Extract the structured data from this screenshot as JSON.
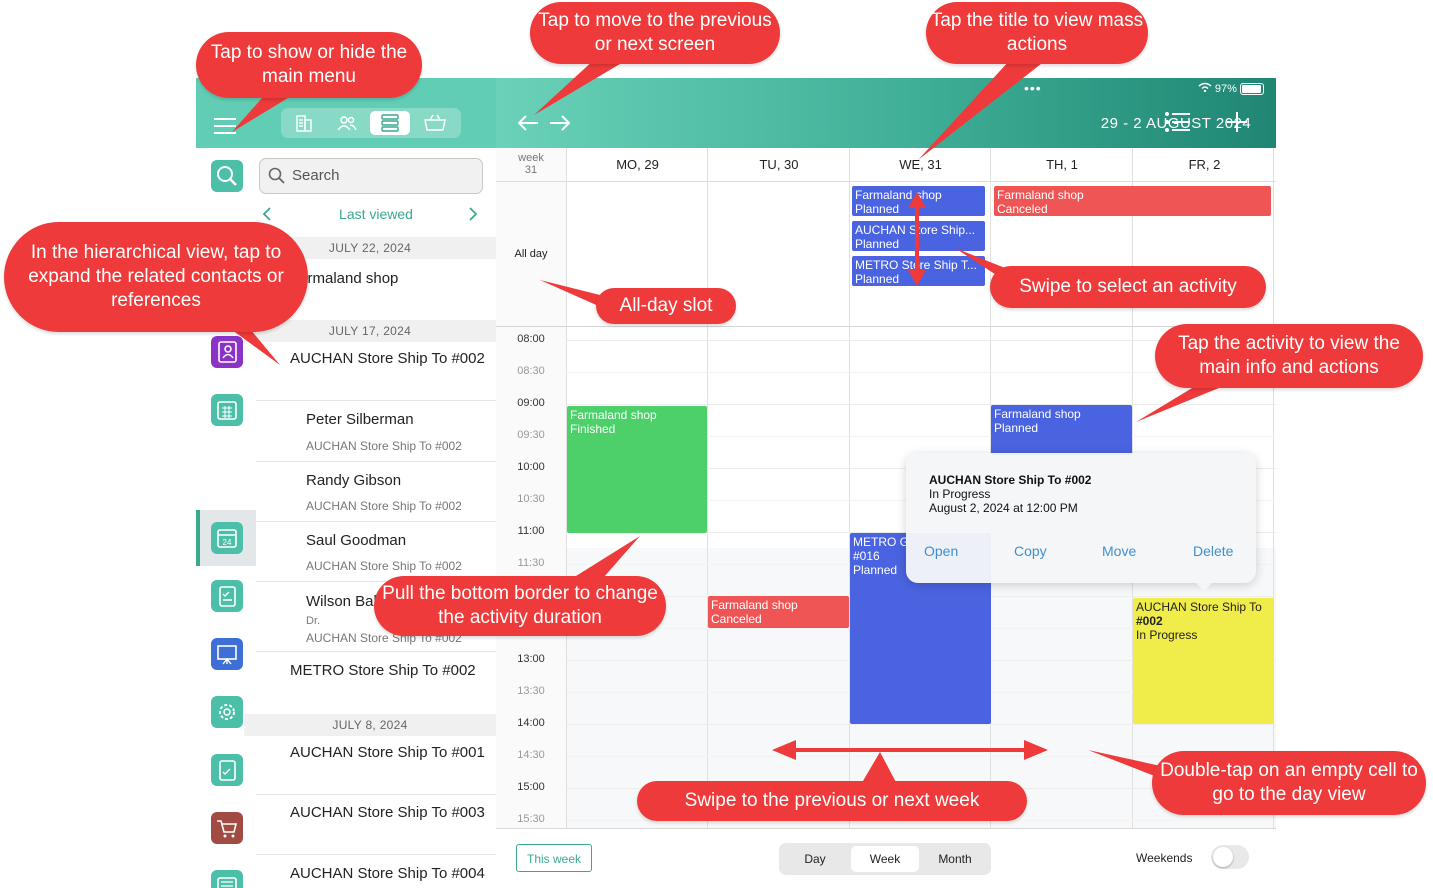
{
  "header": {
    "title": "29 - 2 AUGUST 2024",
    "status_battery": "97%",
    "dots": "•••",
    "segments": [
      "building-icon",
      "people-icon",
      "list-icon",
      "basket-icon"
    ],
    "selected_segment": 2
  },
  "rail": {
    "icons": [
      "search-icon",
      "contacts-book-icon",
      "calendar-grid-icon",
      "calendar-24-icon",
      "clipboard-icon",
      "presentation-icon",
      "settings-icon",
      "checklist-icon",
      "cart-icon",
      "news-icon",
      "star-badge-icon"
    ],
    "selected": 3,
    "calendar_day": "24"
  },
  "list": {
    "search_placeholder": "Search",
    "nav_label": "Last viewed",
    "groups": [
      {
        "date": "JULY 22, 2024",
        "items": [
          {
            "title": "Farmaland shop"
          }
        ]
      },
      {
        "date": "JULY 17, 2024",
        "items": [
          {
            "title": "AUCHAN Store Ship To #002"
          },
          {
            "title": "Peter Silberman",
            "sub": "AUCHAN Store Ship To #002"
          },
          {
            "title": "Randy Gibson",
            "sub": "AUCHAN Store Ship To #002"
          },
          {
            "title": "Saul Goodman",
            "sub": "AUCHAN Store Ship To #002"
          },
          {
            "title": "Wilson Bal",
            "role": "Dr.",
            "sub": "AUCHAN Store Ship To #002"
          },
          {
            "title": "METRO Store Ship To #002"
          }
        ]
      },
      {
        "date": "JULY 8, 2024",
        "items": [
          {
            "title": "AUCHAN Store Ship To #001"
          },
          {
            "title": "AUCHAN Store Ship To #003"
          },
          {
            "title": "AUCHAN Store Ship To #004"
          }
        ]
      }
    ]
  },
  "calendar": {
    "week_label": "week",
    "week_number": "31",
    "all_day_label": "All day",
    "days": [
      "MO,  29",
      "TU,  30",
      "WE,  31",
      "TH,   1",
      "FR,   2"
    ],
    "times": [
      "08:00",
      "08:30",
      "09:00",
      "09:30",
      "10:00",
      "10:30",
      "11:00",
      "11:30",
      "12:00",
      "12:30",
      "13:00",
      "13:30",
      "14:00",
      "14:30",
      "15:00",
      "15:30"
    ],
    "all_day_events": [
      {
        "title": "Farmaland shop",
        "status": "Planned",
        "color": "#4a63e0"
      },
      {
        "title": "AUCHAN Store Ship...",
        "status": "Planned",
        "color": "#4a63e0"
      },
      {
        "title": "METRO Store Ship T...",
        "status": "Planned",
        "color": "#4a63e0"
      },
      {
        "title": "Farmaland shop",
        "status": "Canceled",
        "color": "#ef5555"
      }
    ],
    "events": [
      {
        "title": "Farmaland shop",
        "status": "Finished",
        "color": "#4dd06a"
      },
      {
        "title": "Farmaland shop",
        "status": "Planned",
        "color": "#4a63e0"
      },
      {
        "title": "METRO G",
        "line2": "#016",
        "status": "Planned",
        "color": "#4a63e0"
      },
      {
        "title": "Farmaland shop",
        "status": "Canceled",
        "color": "#ef5555"
      },
      {
        "title": "AUCHAN Store Ship To",
        "line2": "#002",
        "status": "In Progress",
        "color": "#f0ec4a"
      }
    ]
  },
  "popup": {
    "title": "AUCHAN Store Ship To #002",
    "status": "In Progress",
    "datetime": "August 2, 2024 at 12:00 PM",
    "actions": [
      "Open",
      "Copy",
      "Move",
      "Delete"
    ]
  },
  "footer": {
    "this_week": "This week",
    "views": [
      "Day",
      "Week",
      "Month"
    ],
    "selected_view": "Week",
    "weekends_label": "Weekends",
    "weekends_on": false
  },
  "callouts": {
    "menu": "Tap to show or hide the main menu",
    "nav": "Tap to move to the previous or next screen",
    "title": "Tap the title to view mass actions",
    "hier": "In the hierarchical view, tap to expand the related contacts or references",
    "allday": "All-day slot",
    "swipe_select": "Swipe to select an activity",
    "tap_activity": "Tap the activity to view the main info and actions",
    "pull": "Pull the bottom border to change the activity duration",
    "swipe_week": "Swipe to the previous or next week",
    "double_tap": "Double-tap on an empty cell to go to the day view"
  },
  "colors": {
    "accent": "#3aa98f",
    "callout": "#ee3a3a",
    "planned": "#4a63e0",
    "canceled": "#ef5555",
    "finished": "#4dd06a",
    "in_progress": "#f0ec4a"
  }
}
